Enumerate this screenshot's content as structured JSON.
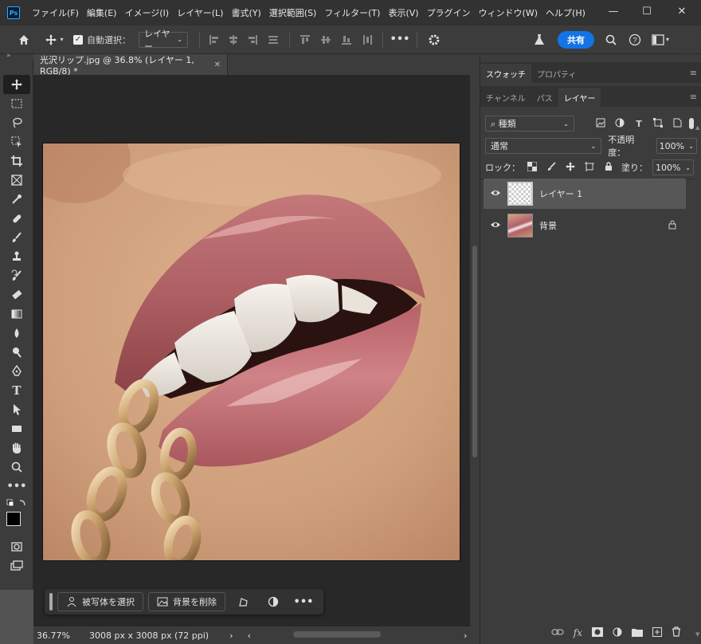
{
  "titlebar": {
    "app_icon": "Ps",
    "menu": [
      "ファイル(F)",
      "編集(E)",
      "イメージ(I)",
      "レイヤー(L)",
      "書式(Y)",
      "選択範囲(S)",
      "フィルター(T)",
      "表示(V)",
      "プラグイン",
      "ウィンドウ(W)",
      "ヘルプ(H)"
    ],
    "min": "—",
    "max": "☐",
    "close": "✕"
  },
  "options": {
    "auto_select_label": "自動選択：",
    "auto_select_target": "レイヤー",
    "share": "共有"
  },
  "document": {
    "tab_title": "光沢リップ.jpg @ 36.8% (レイヤー 1, RGB/8) *",
    "tab_close": "✕"
  },
  "contextbar": {
    "select_subject": "被写体を選択",
    "remove_background": "背景を削除"
  },
  "status": {
    "zoom": "36.77%",
    "doc_info": "3008 px x 3008 px (72 ppi)",
    "arrow": "›"
  },
  "panels": {
    "top_tabs": [
      "スウォッチ",
      "プロパティ"
    ],
    "layer_tabs": [
      "チャンネル",
      "パス",
      "レイヤー"
    ],
    "filter_kind": "種類",
    "blend_mode": "通常",
    "opacity_label": "不透明度：",
    "opacity_value": "100%",
    "lock_label": "ロック：",
    "fill_label": "塗り：",
    "fill_value": "100%",
    "layers": [
      {
        "name": "レイヤー 1",
        "selected": true
      },
      {
        "name": "背景",
        "locked": true
      }
    ]
  },
  "colors": {
    "accent": "#1473e6",
    "panel": "#3c3c3c",
    "canvas_bg": "#282828"
  }
}
